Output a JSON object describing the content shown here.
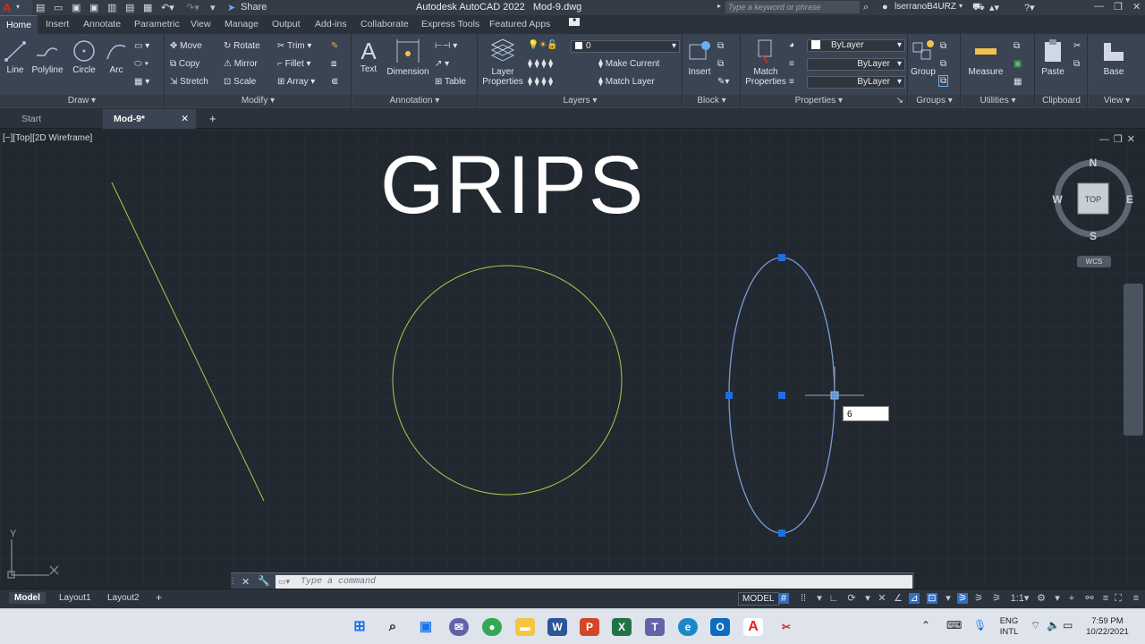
{
  "titlebar": {
    "app_title": "Autodesk AutoCAD 2022",
    "file_name": "Mod-9.dwg",
    "share_label": "Share",
    "search_placeholder": "Type a keyword or phrase",
    "user_name": "lserranoB4URZ"
  },
  "ribbon_tabs": [
    "Home",
    "Insert",
    "Annotate",
    "Parametric",
    "View",
    "Manage",
    "Output",
    "Add-ins",
    "Collaborate",
    "Express Tools",
    "Featured Apps"
  ],
  "panels": {
    "draw": {
      "label": "Draw",
      "tools": [
        "Line",
        "Polyline",
        "Circle",
        "Arc"
      ]
    },
    "modify": {
      "label": "Modify",
      "tools": [
        "Move",
        "Rotate",
        "Trim",
        "Copy",
        "Mirror",
        "Fillet",
        "Stretch",
        "Scale",
        "Array"
      ]
    },
    "annotation": {
      "label": "Annotation",
      "tools": [
        "Text",
        "Dimension",
        "Table"
      ]
    },
    "layers": {
      "label": "Layers",
      "layer_properties": "Layer Properties",
      "current_layer": "0",
      "make_current": "Make Current",
      "match_layer": "Match Layer"
    },
    "block": {
      "label": "Block",
      "insert": "Insert"
    },
    "properties": {
      "label": "Properties",
      "match_properties": "Match Properties",
      "color": "ByLayer",
      "linetype": "ByLayer",
      "lineweight": "ByLayer"
    },
    "groups": {
      "label": "Groups",
      "group": "Group"
    },
    "utilities": {
      "label": "Utilities",
      "measure": "Measure"
    },
    "clipboard": {
      "label": "Clipboard",
      "paste": "Paste"
    },
    "view": {
      "label": "View",
      "base": "Base"
    }
  },
  "file_tabs": [
    "Start",
    "Mod-9*"
  ],
  "viewport": {
    "label": "[−][Top][2D Wireframe]",
    "overlay_title": "GRIPS",
    "dynamic_input_value": "6",
    "viewcube": {
      "face": "TOP",
      "north": "N",
      "south": "S",
      "east": "E",
      "west": "W"
    },
    "wcs_label": "WCS",
    "ucs_y": "Y"
  },
  "command_line": {
    "placeholder": "Type a command"
  },
  "layout_tabs": [
    "Model",
    "Layout1",
    "Layout2"
  ],
  "statusbar": {
    "model_label": "MODEL",
    "scale": "1:1"
  },
  "taskbar": {
    "language": "ENG",
    "region": "INTL",
    "time": "7:59 PM",
    "date": "10/22/2021"
  },
  "colors": {
    "ellipse": "#7a9bd6",
    "circle_line": "#b9c24a",
    "grip": "#1e6fe0"
  }
}
